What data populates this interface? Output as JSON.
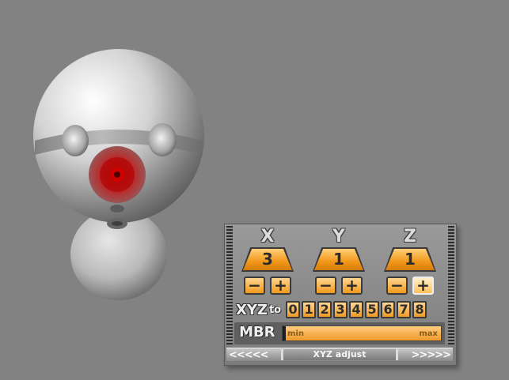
{
  "panel": {
    "axes": [
      {
        "label": "X",
        "value": "3"
      },
      {
        "label": "Y",
        "value": "1"
      },
      {
        "label": "Z",
        "value": "1"
      }
    ],
    "minus_label": "−",
    "plus_label": "+",
    "xyz_title": "XYZ",
    "xyz_to": "to",
    "digits": [
      "0",
      "1",
      "2",
      "3",
      "4",
      "5",
      "6",
      "7",
      "8"
    ],
    "mbr_label": "MBR",
    "slider_min": "min",
    "slider_max": "max",
    "slider_value": 0.0,
    "footer_left": "<<<<<",
    "footer_title": "XYZ adjust",
    "footer_right": ">>>>>"
  },
  "colors": {
    "background": "#828282",
    "accent": "#f29a1e",
    "sphere_red": "#c40000"
  }
}
